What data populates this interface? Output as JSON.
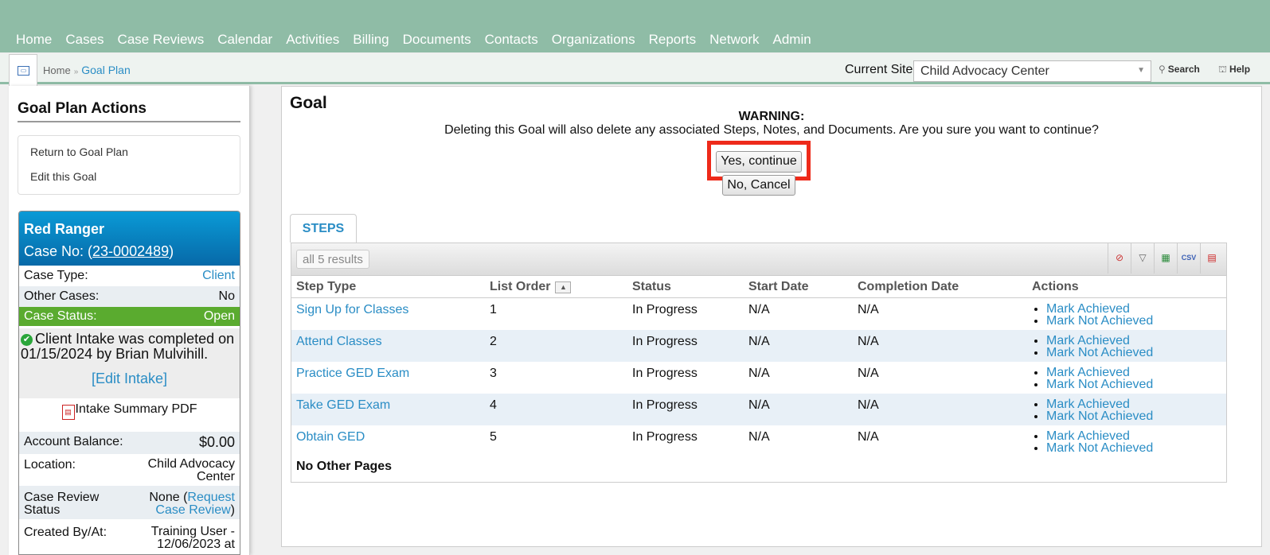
{
  "nav": [
    "Home",
    "Cases",
    "Case Reviews",
    "Calendar",
    "Activities",
    "Billing",
    "Documents",
    "Contacts",
    "Organizations",
    "Reports",
    "Network",
    "Admin"
  ],
  "breadcrumb": {
    "home": "Home",
    "current": "Goal Plan"
  },
  "header": {
    "site_label": "Current Site",
    "site_value": "Child Advocacy Center",
    "search": "Search",
    "help": "Help"
  },
  "left": {
    "title": "Goal Plan Actions",
    "actions": [
      "Return to Goal Plan",
      "Edit this Goal"
    ],
    "case": {
      "name": "Red Ranger",
      "case_no_prefix": "Case No: (",
      "case_no": "23-0002489",
      "case_no_suffix": ")",
      "case_type_k": "Case Type:",
      "case_type_v": "Client",
      "other_cases_k": "Other Cases:",
      "other_cases_v": "No",
      "status_k": "Case Status:",
      "status_v": "Open",
      "intake_text": "Client Intake was completed on 01/15/2024 by Brian Mulvihill.",
      "edit_intake": "[Edit Intake]",
      "pdf": "Intake Summary PDF",
      "balance_k": "Account Balance:",
      "balance_v": "$0.00",
      "location_k": "Location:",
      "location_v1": "Child Advocacy",
      "location_v2": "Center",
      "review_k1": "Case Review",
      "review_k2": "Status",
      "review_v_none": "None (",
      "review_v_link1": "Request",
      "review_v_link2": "Case Review",
      "review_v_close": ")",
      "created_k": "Created By/At:",
      "created_v1": "Training User -",
      "created_v2": "12/06/2023 at"
    }
  },
  "main": {
    "title": "Goal",
    "warning_title": "WARNING:",
    "warning_msg": "Deleting this Goal will also delete any associated Steps, Notes, and Documents. Are you sure you want to continue?",
    "yes_button": "Yes, continue",
    "no_button": "No, Cancel",
    "tab": "STEPS",
    "results": "all 5 results",
    "toolbar_icons": [
      "clear-filter-icon",
      "filter-icon",
      "export-excel-icon",
      "csv-icon",
      "pdf-icon"
    ],
    "toolbar_csv": "CSV",
    "columns": [
      "Step Type",
      "List Order",
      "Status",
      "Start Date",
      "Completion Date",
      "Actions"
    ],
    "rows": [
      {
        "step": "Sign Up for Classes",
        "order": "1",
        "status": "In Progress",
        "start": "N/A",
        "complete": "N/A"
      },
      {
        "step": "Attend Classes",
        "order": "2",
        "status": "In Progress",
        "start": "N/A",
        "complete": "N/A"
      },
      {
        "step": "Practice GED Exam",
        "order": "3",
        "status": "In Progress",
        "start": "N/A",
        "complete": "N/A"
      },
      {
        "step": "Take GED Exam",
        "order": "4",
        "status": "In Progress",
        "start": "N/A",
        "complete": "N/A"
      },
      {
        "step": "Obtain GED",
        "order": "5",
        "status": "In Progress",
        "start": "N/A",
        "complete": "N/A"
      }
    ],
    "action_achieved": "Mark Achieved",
    "action_not_achieved": "Mark Not Achieved",
    "no_other_pages": "No Other Pages"
  },
  "colors": {
    "nav_bg": "#8fbca6",
    "link": "#2a8dc5",
    "status_green": "#5aab2f",
    "highlight": "#ee2a1a",
    "case_header": "#0769a8"
  }
}
